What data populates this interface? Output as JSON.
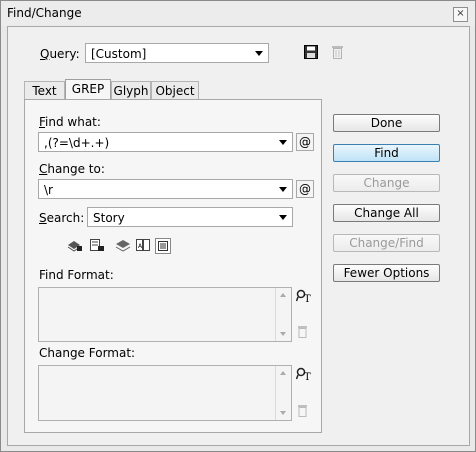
{
  "window": {
    "title": "Find/Change",
    "close_glyph": "×"
  },
  "query": {
    "label": "Query:",
    "value": "[Custom]",
    "save_icon": "save-icon",
    "delete_icon": "trash-icon"
  },
  "tabs": [
    {
      "label": "Text",
      "active": false
    },
    {
      "label": "GREP",
      "active": true
    },
    {
      "label": "Glyph",
      "active": false
    },
    {
      "label": "Object",
      "active": false
    }
  ],
  "find_what": {
    "label": "Find what:",
    "value": ",(?=\\d+.+)",
    "special_chars_button": "@"
  },
  "change_to": {
    "label": "Change to:",
    "value": "\\r",
    "special_chars_button": "@"
  },
  "search": {
    "label": "Search:",
    "value": "Story"
  },
  "find_format": {
    "label": "Find Format:"
  },
  "change_format": {
    "label": "Change Format:"
  },
  "buttons": {
    "done": "Done",
    "find": "Find",
    "change": "Change",
    "change_all": "Change All",
    "change_find": "Change/Find",
    "fewer_options": "Fewer Options"
  },
  "colors": {
    "default_button": "#bfe3f7",
    "disabled_text": "#9a9a9a"
  }
}
